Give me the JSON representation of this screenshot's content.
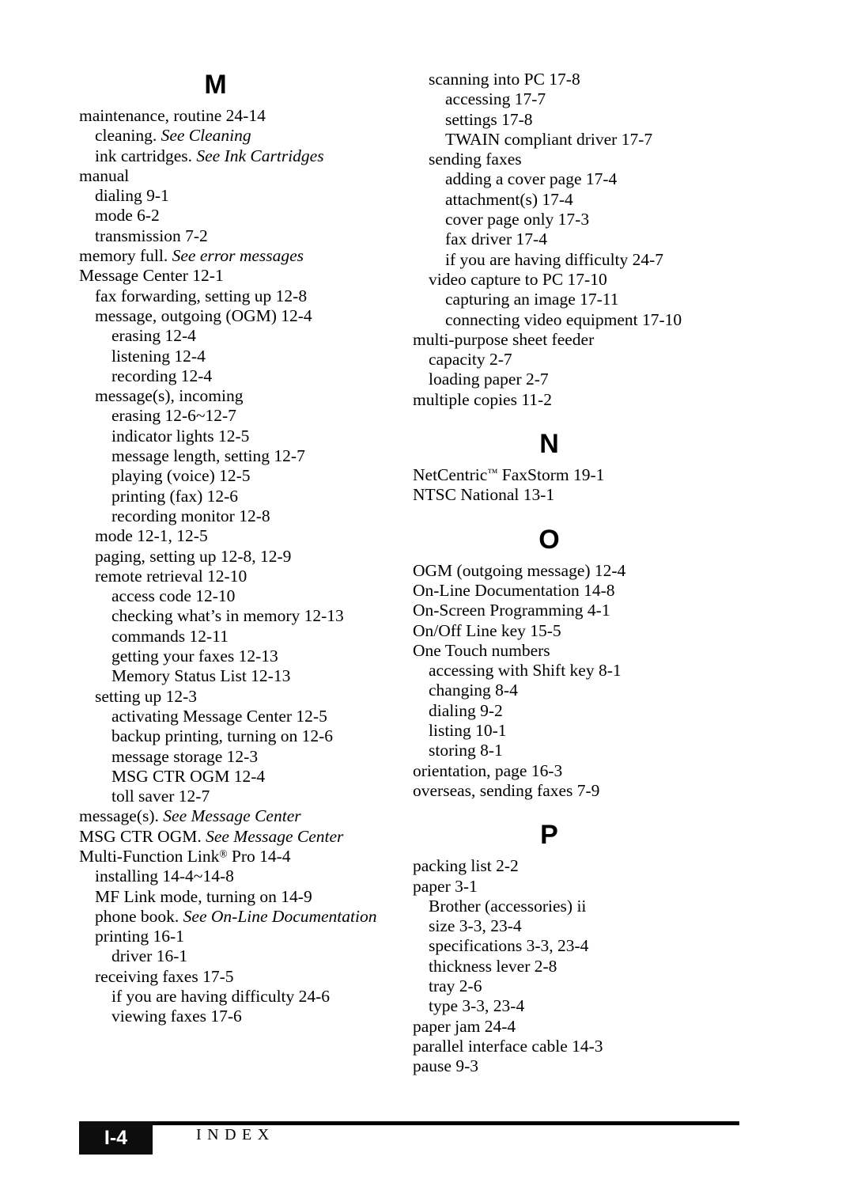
{
  "page": {
    "footer": {
      "page_number": "I-4",
      "label": "INDEX"
    }
  },
  "columns": [
    {
      "name": "left-column",
      "sections": [
        {
          "letter": "M",
          "entries": [
            {
              "level": 0,
              "text": "maintenance, routine  24-14"
            },
            {
              "level": 1,
              "text": "cleaning.  ",
              "see": "See Cleaning"
            },
            {
              "level": 1,
              "text": "ink cartridges.  ",
              "see": "See Ink Cartridges"
            },
            {
              "level": 0,
              "text": "manual"
            },
            {
              "level": 1,
              "text": "dialing  9-1"
            },
            {
              "level": 1,
              "text": "mode  6-2"
            },
            {
              "level": 1,
              "text": "transmission  7-2"
            },
            {
              "level": 0,
              "text": "memory full.  ",
              "see": "See error messages"
            },
            {
              "level": 0,
              "text": "Message Center  12-1"
            },
            {
              "level": 1,
              "text": "fax forwarding, setting up  12-8"
            },
            {
              "level": 1,
              "text": "message, outgoing (OGM)  12-4"
            },
            {
              "level": 2,
              "text": "erasing  12-4"
            },
            {
              "level": 2,
              "text": "listening  12-4"
            },
            {
              "level": 2,
              "text": "recording  12-4"
            },
            {
              "level": 1,
              "text": "message(s), incoming"
            },
            {
              "level": 2,
              "text": "erasing  12-6~12-7"
            },
            {
              "level": 2,
              "text": "indicator lights  12-5"
            },
            {
              "level": 2,
              "text": "message length, setting  12-7"
            },
            {
              "level": 2,
              "text": "playing (voice)  12-5"
            },
            {
              "level": 2,
              "text": "printing (fax)  12-6"
            },
            {
              "level": 2,
              "text": "recording monitor  12-8"
            },
            {
              "level": 1,
              "text": "mode  12-1, 12-5"
            },
            {
              "level": 1,
              "text": "paging, setting up  12-8, 12-9"
            },
            {
              "level": 1,
              "text": "remote retrieval  12-10"
            },
            {
              "level": 2,
              "text": "access code  12-10"
            },
            {
              "level": 2,
              "text": "checking what’s in memory  12-13"
            },
            {
              "level": 2,
              "text": "commands  12-11"
            },
            {
              "level": 2,
              "text": "getting your faxes  12-13"
            },
            {
              "level": 2,
              "text": "Memory Status List  12-13"
            },
            {
              "level": 1,
              "text": "setting up  12-3"
            },
            {
              "level": 2,
              "text": "activating Message Center  12-5"
            },
            {
              "level": 2,
              "text": "backup printing, turning on  12-6"
            },
            {
              "level": 2,
              "text": "message storage  12-3"
            },
            {
              "level": 2,
              "text": "MSG CTR OGM  12-4"
            },
            {
              "level": 2,
              "text": "toll saver  12-7"
            },
            {
              "level": 0,
              "text": "message(s).  ",
              "see": "See Message Center"
            },
            {
              "level": 0,
              "text": "MSG CTR OGM.  ",
              "see": "See Message Center"
            },
            {
              "level": 0,
              "text": "Multi-Function Link",
              "sup": "®",
              "text_after": " Pro  14-4"
            },
            {
              "level": 1,
              "text": "installing  14-4~14-8"
            },
            {
              "level": 1,
              "text": "MF Link mode, turning on  14-9"
            },
            {
              "level": 1,
              "text": "phone book.  ",
              "see": "See On-Line Documentation"
            },
            {
              "level": 1,
              "text": "printing  16-1"
            },
            {
              "level": 2,
              "text": "driver  16-1"
            },
            {
              "level": 1,
              "text": "receiving faxes  17-5"
            },
            {
              "level": 2,
              "text": "if you are having difficulty  24-6"
            },
            {
              "level": 2,
              "text": "viewing faxes  17-6"
            }
          ]
        }
      ]
    },
    {
      "name": "right-column",
      "sections": [
        {
          "letter": "",
          "entries": [
            {
              "level": 1,
              "text": "scanning into PC  17-8"
            },
            {
              "level": 2,
              "text": "accessing  17-7"
            },
            {
              "level": 2,
              "text": "settings  17-8"
            },
            {
              "level": 2,
              "text": "TWAIN compliant driver  17-7"
            },
            {
              "level": 1,
              "text": "sending faxes"
            },
            {
              "level": 2,
              "text": "adding a cover page  17-4"
            },
            {
              "level": 2,
              "text": "attachment(s)  17-4"
            },
            {
              "level": 2,
              "text": "cover page only  17-3"
            },
            {
              "level": 2,
              "text": "fax driver  17-4"
            },
            {
              "level": 2,
              "text": "if you are having difficulty  24-7"
            },
            {
              "level": 1,
              "text": "video capture to PC  17-10"
            },
            {
              "level": 2,
              "text": "capturing an image  17-11"
            },
            {
              "level": 2,
              "text": "connecting video equipment  17-10"
            },
            {
              "level": 0,
              "text": "multi-purpose sheet feeder"
            },
            {
              "level": 1,
              "text": "capacity  2-7"
            },
            {
              "level": 1,
              "text": "loading paper  2-7"
            },
            {
              "level": 0,
              "text": "multiple copies  11-2"
            }
          ]
        },
        {
          "letter": "N",
          "entries": [
            {
              "level": 0,
              "text": "NetCentric",
              "sup": "™",
              "text_after": " FaxStorm  19-1"
            },
            {
              "level": 0,
              "text": "NTSC National  13-1"
            }
          ]
        },
        {
          "letter": "O",
          "entries": [
            {
              "level": 0,
              "text": "OGM (outgoing message)  12-4"
            },
            {
              "level": 0,
              "text": "On-Line Documentation  14-8"
            },
            {
              "level": 0,
              "text": "On-Screen Programming  4-1"
            },
            {
              "level": 0,
              "text": "On/Off Line key  15-5"
            },
            {
              "level": 0,
              "text": "One Touch numbers"
            },
            {
              "level": 1,
              "text": "accessing with Shift key  8-1"
            },
            {
              "level": 1,
              "text": "changing  8-4"
            },
            {
              "level": 1,
              "text": "dialing  9-2"
            },
            {
              "level": 1,
              "text": "listing  10-1"
            },
            {
              "level": 1,
              "text": "storing  8-1"
            },
            {
              "level": 0,
              "text": "orientation, page  16-3"
            },
            {
              "level": 0,
              "text": "overseas, sending faxes  7-9"
            }
          ]
        },
        {
          "letter": "P",
          "entries": [
            {
              "level": 0,
              "text": "packing list  2-2"
            },
            {
              "level": 0,
              "text": "paper  3-1"
            },
            {
              "level": 1,
              "text": "Brother (accessories)  ii"
            },
            {
              "level": 1,
              "text": "size  3-3, 23-4"
            },
            {
              "level": 1,
              "text": "specifications  3-3, 23-4"
            },
            {
              "level": 1,
              "text": "thickness lever  2-8"
            },
            {
              "level": 1,
              "text": "tray  2-6"
            },
            {
              "level": 1,
              "text": "type  3-3, 23-4"
            },
            {
              "level": 0,
              "text": "paper jam  24-4"
            },
            {
              "level": 0,
              "text": "parallel interface cable  14-3"
            },
            {
              "level": 0,
              "text": "pause  9-3"
            }
          ]
        }
      ]
    }
  ]
}
